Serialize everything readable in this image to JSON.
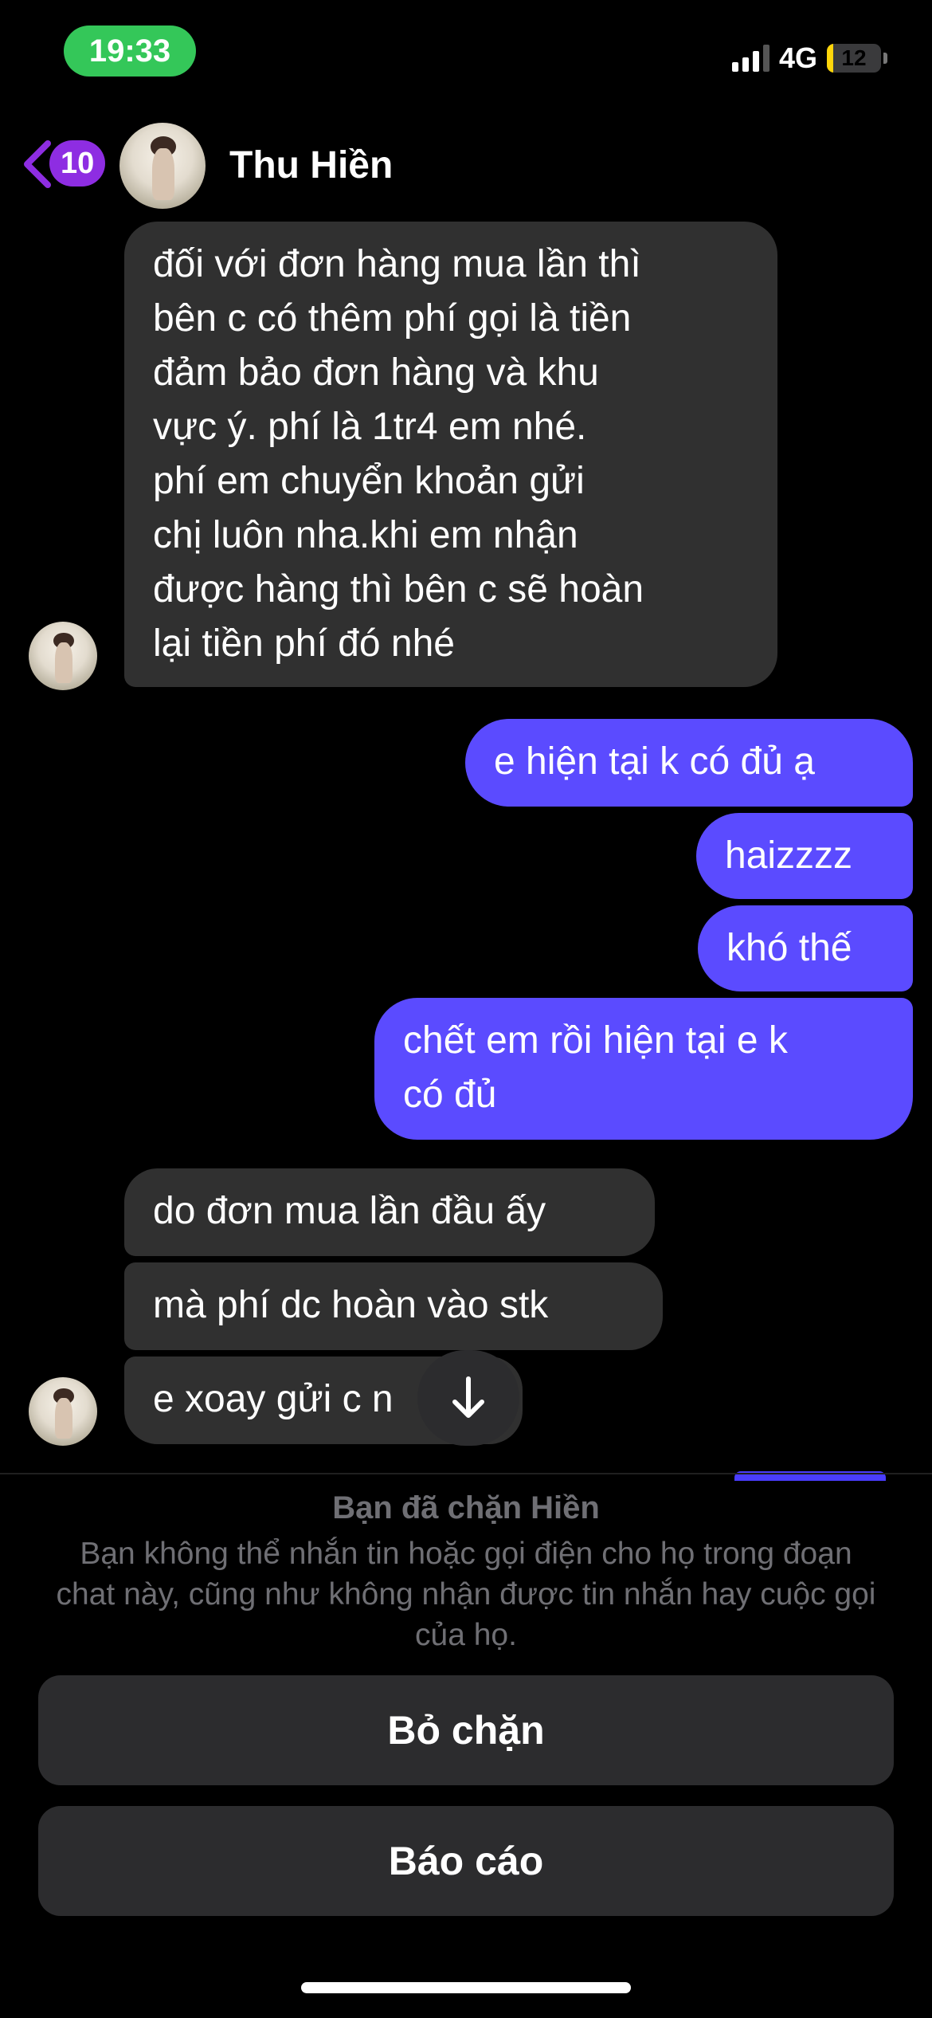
{
  "status_bar": {
    "time": "19:33",
    "network": "4G",
    "battery": "12",
    "battery_level": 0.12
  },
  "header": {
    "back_badge": "10",
    "contact_name": "Thu Hiền"
  },
  "messages": [
    {
      "from": "them",
      "lines": [
        "đối với đơn hàng mua lần thì",
        "bên c có thêm phí gọi là tiền",
        "đảm bảo đơn hàng và khu",
        "vực  ý. phí là 1tr4 em nhé.",
        "phí em chuyển khoản  gửi",
        "chị luôn nha.khi em nhận",
        "được hàng thì bên c sẽ hoàn",
        "lại tiền phí đó nhé"
      ]
    },
    {
      "from": "me",
      "text": "e hiện tại k có đủ ạ"
    },
    {
      "from": "me",
      "text": "haizzzz"
    },
    {
      "from": "me",
      "text": "khó thế"
    },
    {
      "from": "me",
      "lines": [
        "chết em rồi hiện tại e k",
        "có đủ"
      ]
    },
    {
      "from": "them",
      "text": "do đơn mua lần đầu ấy"
    },
    {
      "from": "them",
      "text": "mà phí dc hoàn vào stk"
    },
    {
      "from": "them",
      "text": "e xoay gửi c n"
    }
  ],
  "blocked": {
    "title": "Bạn đã chặn Hiền",
    "description": "Bạn không thể nhắn tin hoặc gọi điện cho họ trong đoạn chat này, cũng như không nhận được tin nhắn hay cuộc gọi của họ.",
    "unblock_label": "Bỏ chặn",
    "report_label": "Báo cáo"
  },
  "colors": {
    "sent_bubble": "#5b4bff",
    "received_bubble": "#303030",
    "badge": "#8e2de2",
    "time_pill": "#34c759"
  }
}
